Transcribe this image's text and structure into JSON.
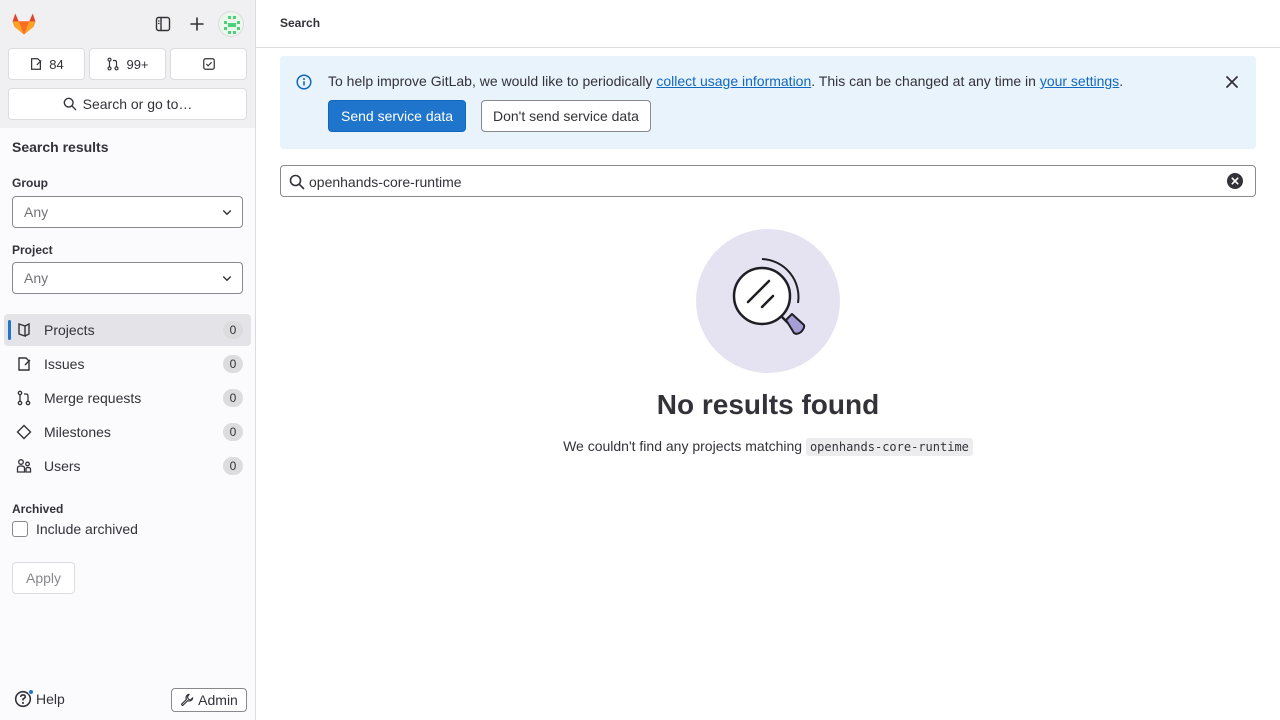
{
  "sidebar": {
    "counters": {
      "issues": "84",
      "merge_requests": "99+"
    },
    "search_label": "Search or go to…",
    "heading": "Search results",
    "filters": {
      "group_label": "Group",
      "group_value": "Any",
      "project_label": "Project",
      "project_value": "Any"
    },
    "nav": [
      {
        "label": "Projects",
        "count": "0",
        "icon": "project-icon"
      },
      {
        "label": "Issues",
        "count": "0",
        "icon": "issues-icon"
      },
      {
        "label": "Merge requests",
        "count": "0",
        "icon": "merge-request-icon"
      },
      {
        "label": "Milestones",
        "count": "0",
        "icon": "milestone-icon"
      },
      {
        "label": "Users",
        "count": "0",
        "icon": "users-icon"
      }
    ],
    "archived_label": "Archived",
    "include_archived_label": "Include archived",
    "apply_label": "Apply",
    "help_label": "Help",
    "admin_label": "Admin"
  },
  "header": {
    "breadcrumb": "Search"
  },
  "alert": {
    "text_before": "To help improve GitLab, we would like to periodically ",
    "link1": "collect usage information",
    "text_middle": ". This can be changed at any time in ",
    "link2": "your settings",
    "text_after": ".",
    "primary_button": "Send service data",
    "secondary_button": "Don't send service data"
  },
  "search": {
    "value": "openhands-core-runtime"
  },
  "empty_state": {
    "title": "No results found",
    "description": "We couldn't find any projects matching",
    "query": "openhands-core-runtime"
  },
  "colors": {
    "accent": "#1f75cb",
    "alert_bg": "#e9f3fc",
    "sidebar_bg": "#fbfafd"
  }
}
